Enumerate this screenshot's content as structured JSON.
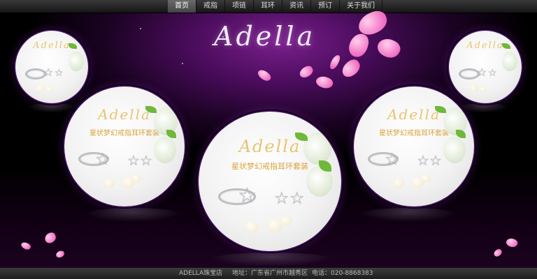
{
  "nav": {
    "items": [
      "首页",
      "戒指",
      "项链",
      "耳环",
      "资讯",
      "预订",
      "关于我们"
    ],
    "active_index": 0
  },
  "logo": "Adella",
  "products": {
    "brand": "Adella",
    "title": "星状梦幻戒指耳环套装"
  },
  "footer": {
    "store": "ADELLA珠宝店",
    "address": "地址：广东省广州市越秀区",
    "phone": "电话：020-8868383"
  },
  "colors": {
    "accent": "#7a1f8c",
    "petal": "#f06ac0",
    "leaf": "#6fb83a",
    "gold_text": "#d9a23a"
  }
}
